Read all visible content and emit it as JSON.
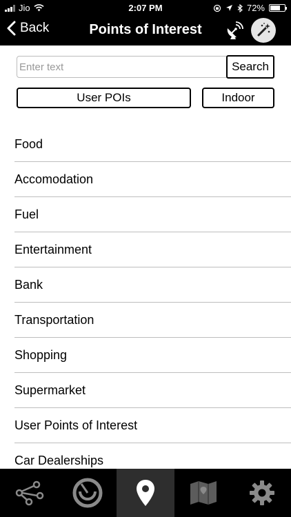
{
  "status_bar": {
    "carrier": "Jio",
    "time": "2:07 PM",
    "battery_percent": "72%",
    "battery_level": 0.72
  },
  "nav": {
    "back_label": "Back",
    "title": "Points of Interest",
    "icons": [
      "satellite-dish-icon",
      "magic-wand-icon"
    ]
  },
  "search": {
    "placeholder": "Enter text",
    "value": "",
    "button_label": "Search"
  },
  "filters": {
    "user_pois_label": "User POIs",
    "indoor_label": "Indoor"
  },
  "categories": [
    "Food",
    "Accomodation",
    "Fuel",
    "Entertainment",
    "Bank",
    "Transportation",
    "Shopping",
    "Supermarket",
    "User Points of Interest",
    "Car Dealerships"
  ],
  "tabbar": {
    "tabs": [
      {
        "icon": "route-nodes-icon",
        "active": false
      },
      {
        "icon": "radar-icon",
        "active": false
      },
      {
        "icon": "location-pin-icon",
        "active": true
      },
      {
        "icon": "map-icon",
        "active": false
      },
      {
        "icon": "gear-icon",
        "active": false
      }
    ]
  },
  "colors": {
    "bars": "#000000",
    "active_tab": "#2e2e2e",
    "divider": "#bdbdbd",
    "inactive_icon": "#8a8a8a"
  }
}
